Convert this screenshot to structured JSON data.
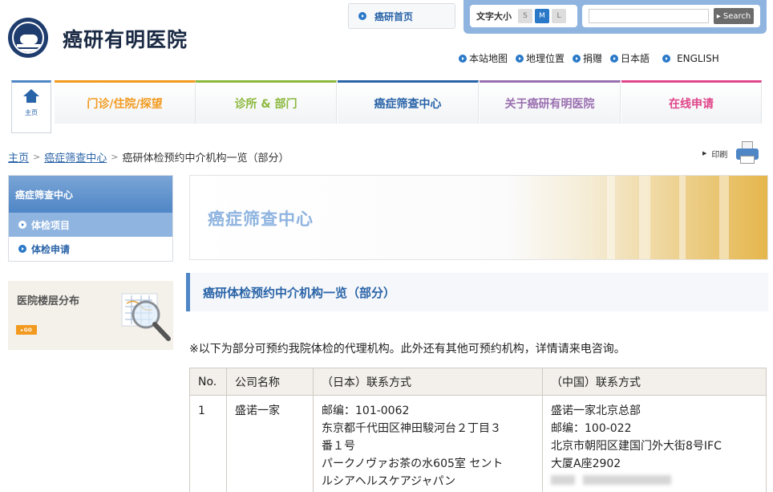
{
  "site": {
    "name": "癌研有明医院"
  },
  "header": {
    "home_link": "癌研首页",
    "font_size_label": "文字大小",
    "font_sizes": [
      "S",
      "M",
      "L"
    ],
    "search_button": "▸ Search",
    "search_placeholder": ""
  },
  "utility_links": [
    "本站地图",
    "地理位置",
    "捐赠",
    "日本語",
    "ENGLISH"
  ],
  "gnav": {
    "home_label": "主页",
    "items": [
      {
        "label": "门诊/住院/探望",
        "color": "#f29a1f"
      },
      {
        "label": "诊所 & 部门",
        "color": "#8bb83c"
      },
      {
        "label": "癌症筛查中心",
        "color": "#2a64a8"
      },
      {
        "label": "关于癌研有明医院",
        "color": "#9a6fb0"
      },
      {
        "label": "在线申请",
        "color": "#e0468a"
      }
    ]
  },
  "breadcrumb": {
    "items": [
      "主页",
      "癌症筛查中心"
    ],
    "current": "癌研体检预约中介机构一览（部分）"
  },
  "print_label": "印刷",
  "sidebar": {
    "heading": "癌症筛查中心",
    "items": [
      {
        "label": "体检项目",
        "active": true
      },
      {
        "label": "体检申请",
        "active": false
      }
    ],
    "floor_map_title": "医院楼层分布",
    "floor_map_go": "GO"
  },
  "banner_title": "癌症筛查中心",
  "section_title": "癌研体检预约中介机构一览（部分）",
  "notice": "※以下为部分可预约我院体检的代理机构。此外还有其他可预约机构，详情请来电咨询。",
  "table": {
    "headers": [
      "No.",
      "公司名称",
      "（日本）联系方式",
      "（中国）联系方式"
    ],
    "rows": [
      {
        "no": "1",
        "company": "盛诺一家",
        "japan": [
          "邮编：101-0062",
          "东京都千代田区神田駿河台２丁目３",
          "番１号",
          "パークノヴァお茶の水605室 セント",
          "ルシアヘルスケアジャパン"
        ],
        "china": [
          "盛诺一家北京总部",
          "邮编：100-022",
          "北京市朝阳区建国门外大街8号IFC",
          "大厦A座2902"
        ]
      }
    ]
  },
  "colors": {
    "accent": "#4f86c6",
    "link": "#2a64a8",
    "tool_bar": "#8fb4e0"
  }
}
